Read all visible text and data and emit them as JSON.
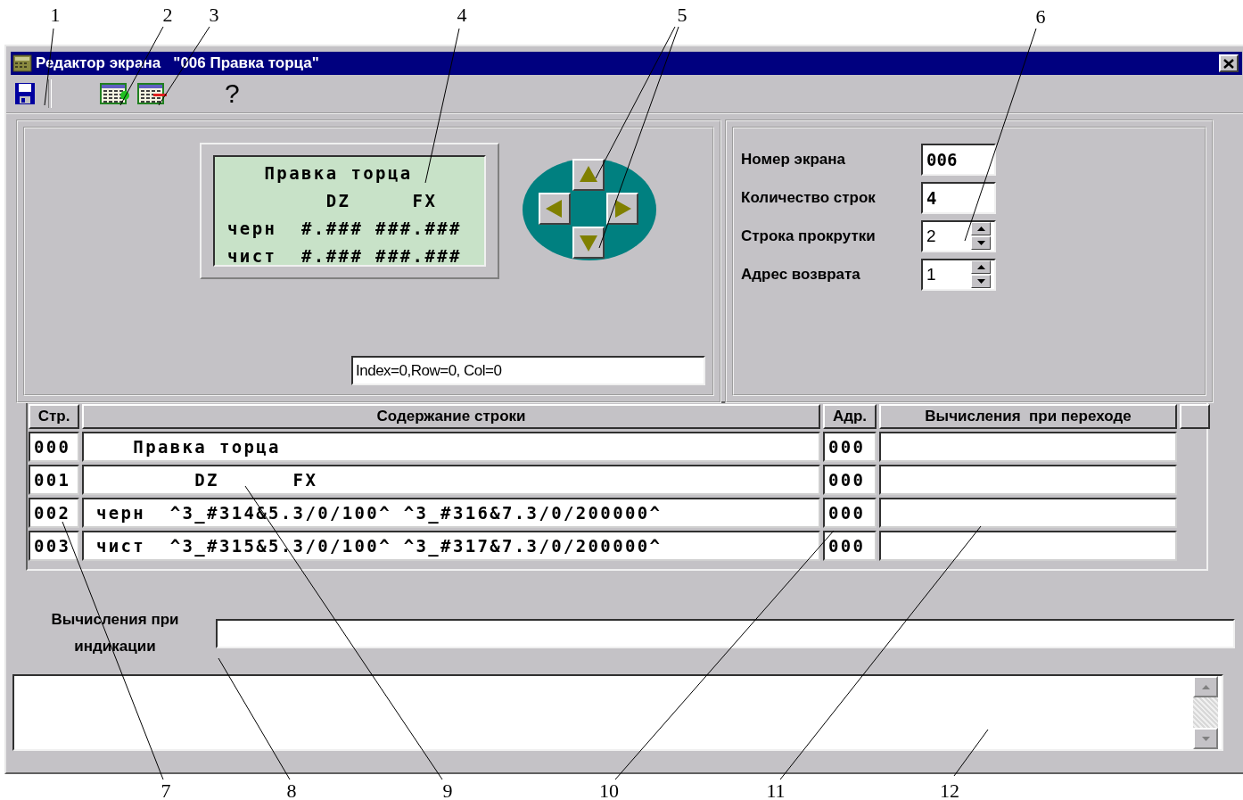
{
  "window": {
    "title": "Редактор экрана   \"006 Правка торца\""
  },
  "toolbar": {
    "help": "?"
  },
  "preview": {
    "lines": [
      "   Правка торца",
      "        DZ     FX",
      "черн  #.### ###.###",
      "чист  #.### ###.###"
    ]
  },
  "status_field": {
    "value": "Index=0,Row=0, Col=0"
  },
  "properties": [
    {
      "label": "Номер экрана",
      "value": "006",
      "kind": "text"
    },
    {
      "label": "Количество строк",
      "value": "4",
      "kind": "text"
    },
    {
      "label": "Строка прокрутки",
      "value": "2",
      "kind": "spin"
    },
    {
      "label": "Адрес возврата",
      "value": "1",
      "kind": "spin"
    }
  ],
  "table": {
    "columns": [
      "Стр.",
      "Содержание строки",
      "Адр.",
      "Вычисления  при переходе"
    ],
    "rows": [
      {
        "number": "000",
        "content": "   Правка торца",
        "address": "000"
      },
      {
        "number": "001",
        "content": "        DZ      FX",
        "address": "000"
      },
      {
        "number": "002",
        "content": "черн  ^3_#314&5.3/0/100^ ^3_#316&7.3/0/200000^",
        "address": "000"
      },
      {
        "number": "003",
        "content": "чист  ^3_#315&5.3/0/100^ ^3_#317&7.3/0/200000^",
        "address": "000"
      }
    ]
  },
  "indication": {
    "label": "Вычисления при индикации"
  },
  "callouts": [
    {
      "label": "1"
    },
    {
      "label": "2"
    },
    {
      "label": "3"
    },
    {
      "label": "4"
    },
    {
      "label": "5"
    },
    {
      "label": "6"
    },
    {
      "label": "7"
    },
    {
      "label": "8"
    },
    {
      "label": "9"
    },
    {
      "label": "10"
    },
    {
      "label": "11"
    },
    {
      "label": "12"
    }
  ]
}
